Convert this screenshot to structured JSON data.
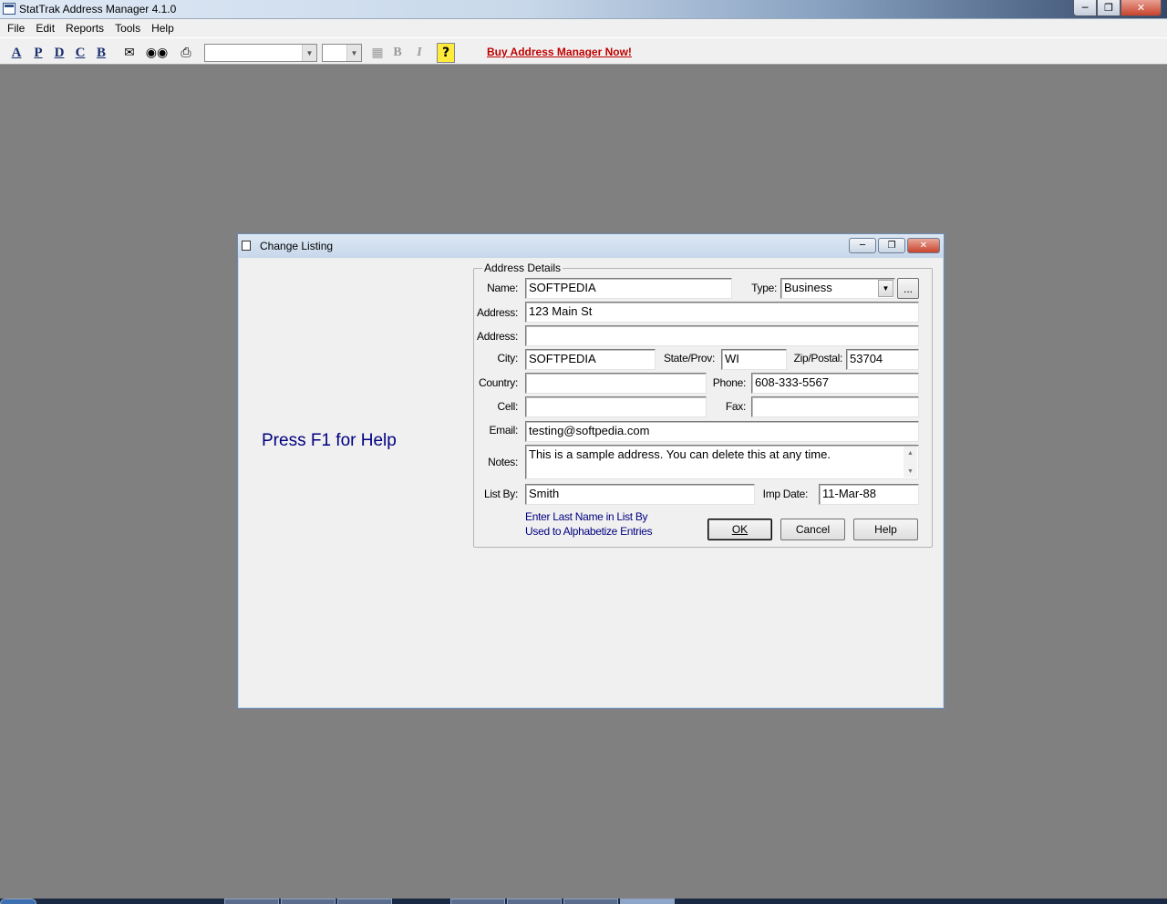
{
  "window": {
    "title": "StatTrak Address Manager 4.1.0",
    "min_icon": "minimize-icon",
    "max_icon": "maximize-icon",
    "close_icon": "close-icon"
  },
  "menu": [
    "File",
    "Edit",
    "Reports",
    "Tools",
    "Help"
  ],
  "toolbar": {
    "letters": [
      "A",
      "P",
      "D",
      "C",
      "B"
    ],
    "icons": [
      "envelope-icon",
      "binoculars-icon",
      "printer-icon"
    ],
    "bold_label": "B",
    "italic_label": "I",
    "help_icon": "question-icon",
    "buy_link": "Buy Address Manager Now!"
  },
  "dialog": {
    "title": "Change Listing",
    "help_text": "Press F1 for Help",
    "group_title": "Address Details",
    "fields": {
      "name_label": "Name:",
      "name_value": "SOFTPEDIA",
      "type_label": "Type:",
      "type_value": "Business",
      "more_button": "...",
      "address1_label": "Address:",
      "address1_value": "123 Main St",
      "address2_label": "Address:",
      "address2_value": "",
      "city_label": "City:",
      "city_value": "SOFTPEDIA",
      "state_label": "State/Prov:",
      "state_value": "WI",
      "zip_label": "Zip/Postal:",
      "zip_value": "53704",
      "country_label": "Country:",
      "country_value": "",
      "phone_label": "Phone:",
      "phone_value": "608-333-5567",
      "cell_label": "Cell:",
      "cell_value": "",
      "fax_label": "Fax:",
      "fax_value": "",
      "email_label": "Email:",
      "email_value": "testing@softpedia.com",
      "notes_label": "Notes:",
      "notes_value": "This is a sample address.  You can delete this at any time.",
      "listby_label": "List By:",
      "listby_value": "Smith",
      "impdate_label": "Imp Date:",
      "impdate_value": "11-Mar-88"
    },
    "hint_line1": "Enter Last Name in List By",
    "hint_line2": "Used to Alphabetize Entries",
    "buttons": {
      "ok": "OK",
      "cancel": "Cancel",
      "help": "Help"
    }
  }
}
